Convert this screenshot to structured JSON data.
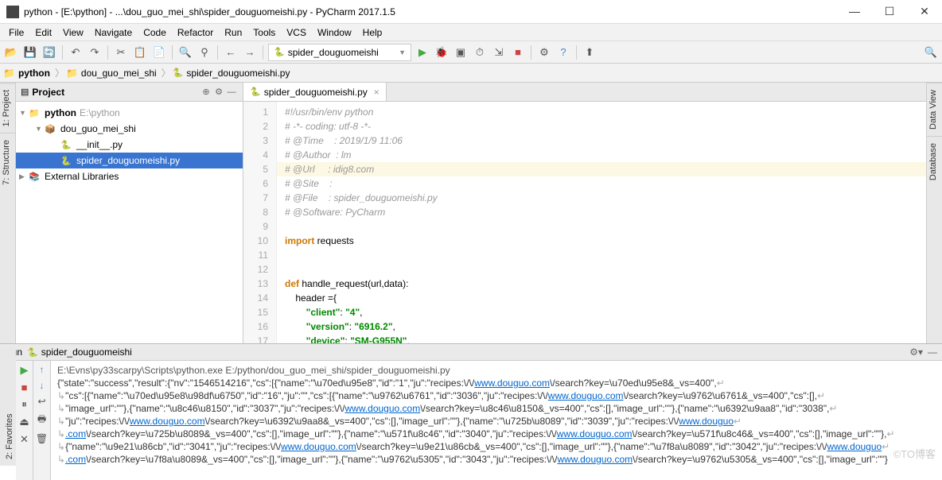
{
  "window": {
    "title": "python - [E:\\python] - ...\\dou_guo_mei_shi\\spider_douguomeishi.py - PyCharm 2017.1.5",
    "min": "—",
    "max": "☐",
    "close": "✕"
  },
  "menu": [
    "File",
    "Edit",
    "View",
    "Navigate",
    "Code",
    "Refactor",
    "Run",
    "Tools",
    "VCS",
    "Window",
    "Help"
  ],
  "run_config": "spider_douguomeishi",
  "breadcrumbs": {
    "root": "python",
    "folder": "dou_guo_mei_shi",
    "file": "spider_douguomeishi.py"
  },
  "project_panel": {
    "title": "Project"
  },
  "left_tabs": [
    "1: Project",
    "7: Structure"
  ],
  "right_tabs": [
    "Data View",
    "Database"
  ],
  "bottom_tab": "2: Favorites",
  "tree": {
    "root": {
      "name": "python",
      "loc": "E:\\python"
    },
    "pkg": "dou_guo_mei_shi",
    "init": "__init__.py",
    "file": "spider_douguomeishi.py",
    "ext": "External Libraries"
  },
  "editor": {
    "tab": "spider_douguomeishi.py",
    "lines": [
      {
        "n": 1,
        "cls": "cm",
        "t": "#!/usr/bin/env python"
      },
      {
        "n": 2,
        "cls": "cm",
        "t": "# -*- coding: utf-8 -*-"
      },
      {
        "n": 3,
        "cls": "cm",
        "t": "# @Time    : 2019/1/9 11:06"
      },
      {
        "n": 4,
        "cls": "cm",
        "t": "# @Author  : lm"
      },
      {
        "n": 5,
        "cls": "cm hl",
        "t": "# @Url     : idig8.com"
      },
      {
        "n": 6,
        "cls": "cm",
        "t": "# @Site    :"
      },
      {
        "n": 7,
        "cls": "cm",
        "t": "# @File    : spider_douguomeishi.py"
      },
      {
        "n": 8,
        "cls": "cm",
        "t": "# @Software: PyCharm"
      },
      {
        "n": 9,
        "cls": "",
        "t": ""
      },
      {
        "n": 10,
        "cls": "",
        "t": "import requests"
      },
      {
        "n": 11,
        "cls": "",
        "t": ""
      },
      {
        "n": 12,
        "cls": "",
        "t": ""
      },
      {
        "n": 13,
        "cls": "",
        "t": "def handle_request(url,data):"
      },
      {
        "n": 14,
        "cls": "",
        "t": "    header ={"
      },
      {
        "n": 15,
        "cls": "",
        "t": "        \"client\": \"4\","
      },
      {
        "n": 16,
        "cls": "",
        "t": "        \"version\": \"6916.2\","
      },
      {
        "n": 17,
        "cls": "",
        "t": "        \"device\": \"SM-G955N\","
      }
    ]
  },
  "run": {
    "title": "Run",
    "name": "spider_douguomeishi",
    "cmd": "E:\\Evns\\py33scarpy\\Scripts\\python.exe E:/python/dou_guo_mei_shi/spider_douguomeishi.py",
    "out1_a": "{\"state\":\"success\",\"result\":{\"nv\":\"1546514216\",\"cs\":[{\"name\":\"\\u70ed\\u95e8\",\"id\":\"1\",\"ju\":\"recipes:\\/\\/",
    "link1": "www.douguo.com",
    "out1_b": "\\/search?key=\\u70ed\\u95e8&_vs=400\",",
    "out2_a": "\"cs\":[{\"name\":\"\\u70ed\\u95e8\\u98df\\u6750\",\"id\":\"16\",\"ju\":\"\",\"cs\":[{\"name\":\"\\u9762\\u6761\",\"id\":\"3036\",\"ju\":\"recipes:\\/\\/",
    "out2_b": "\\/search?key=\\u9762\\u6761&_vs=400\",\"cs\":[],",
    "out3_a": "\"image_url\":\"\"},{\"name\":\"\\u8c46\\u8150\",\"id\":\"3037\",\"ju\":\"recipes:\\/\\/",
    "out3_b": "\\/search?key=\\u8c46\\u8150&_vs=400\",\"cs\":[],\"image_url\":\"\"},{\"name\":\"\\u6392\\u9aa8\",\"id\":\"3038\",",
    "out4_a": "\"ju\":\"recipes:\\/\\/",
    "out4_b": "\\/search?key=\\u6392\\u9aa8&_vs=400\",\"cs\":[],\"image_url\":\"\"},{\"name\":\"\\u725b\\u8089\",\"id\":\"3039\",\"ju\":\"recipes:\\/\\/",
    "link2": "www.douguo",
    "out5_a": ".com",
    "out5_b": "\\/search?key=\\u725b\\u8089&_vs=400\",\"cs\":[],\"image_url\":\"\"},{\"name\":\"\\u571f\\u8c46\",\"id\":\"3040\",\"ju\":\"recipes:\\/\\/",
    "out5_c": "\\/search?key=\\u571f\\u8c46&_vs=400\",\"cs\":[],\"image_url\":\"\"},",
    "out6_a": "{\"name\":\"\\u9e21\\u86cb\",\"id\":\"3041\",\"ju\":\"recipes:\\/\\/",
    "out6_b": "\\/search?key=\\u9e21\\u86cb&_vs=400\",\"cs\":[],\"image_url\":\"\"},{\"name\":\"\\u7f8a\\u8089\",\"id\":\"3042\",\"ju\":\"recipes:\\/\\/",
    "out7_a": ".com",
    "out7_b": "\\/search?key=\\u7f8a\\u8089&_vs=400\",\"cs\":[],\"image_url\":\"\"},{\"name\":\"\\u9762\\u5305\",\"id\":\"3043\",\"ju\":\"recipes:\\/\\/",
    "out7_c": "\\/search?key=\\u9762\\u5305&_vs=400\",\"cs\":[],\"image_url\":\"\"}"
  },
  "watermark": "©TO博客"
}
